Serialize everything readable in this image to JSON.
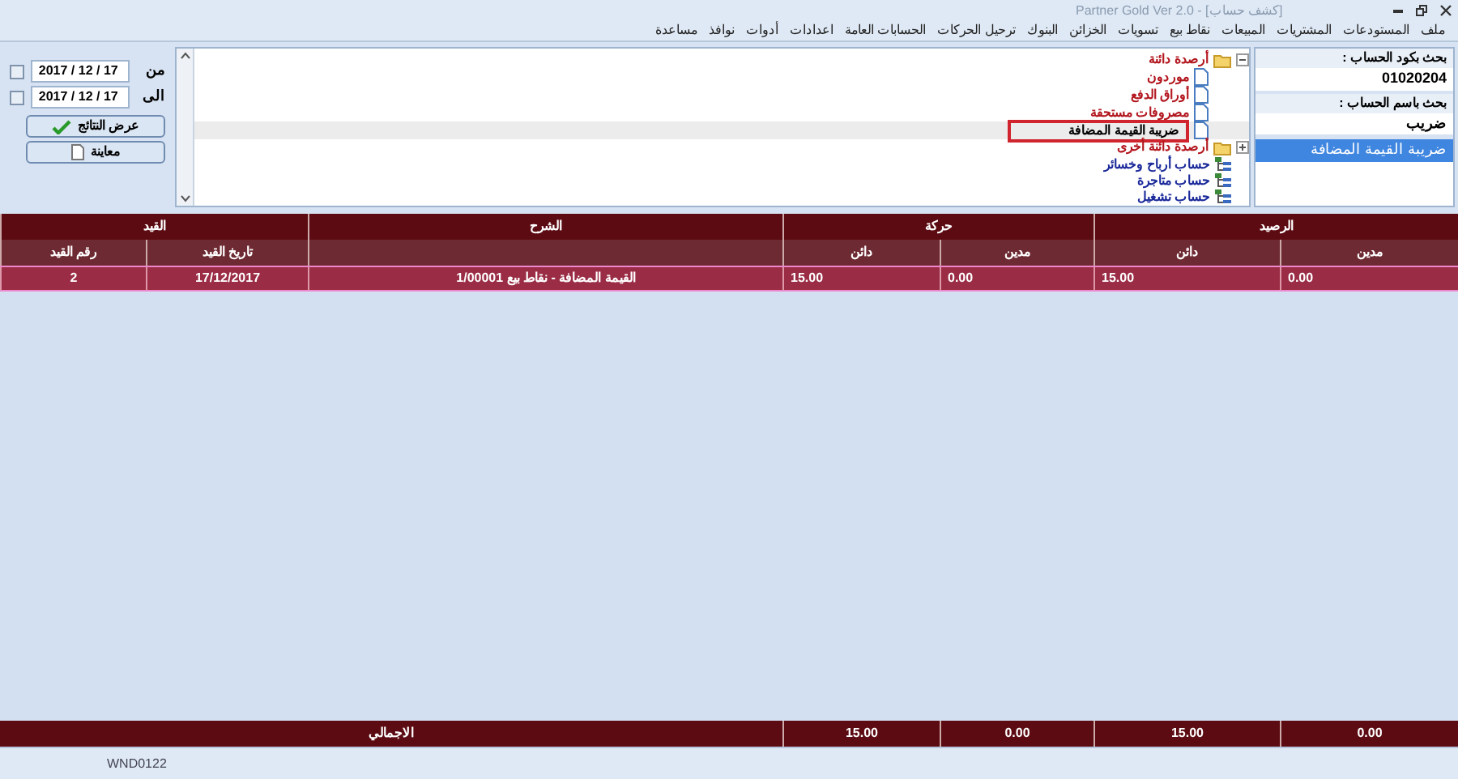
{
  "window": {
    "title": "[كشف حساب] - Partner Gold Ver 2.0"
  },
  "menu": [
    "ملف",
    "المستودعات",
    "المشتريات",
    "المبيعات",
    "نقاط بيع",
    "تسويات",
    "الخزائن",
    "البنوك",
    "ترحيل الحركات",
    "الحسابات العامة",
    "اعدادات",
    "أدوات",
    "نوافذ",
    "مساعدة"
  ],
  "search": {
    "code_label": "بحث بكود الحساب :",
    "code_value": "01020204",
    "name_label": "بحث باسم الحساب :",
    "name_value": "ضريب",
    "results": [
      {
        "label": "ضريبة القيمة المضافة",
        "selected": true
      }
    ]
  },
  "tree": [
    {
      "label": "أرصدة دائنة",
      "kind": "folder",
      "expanded": true,
      "selected": false,
      "children": [
        {
          "label": "موردون",
          "kind": "doc",
          "selected": false
        },
        {
          "label": "أوراق الدفع",
          "kind": "doc",
          "selected": false
        },
        {
          "label": "مصروفات مستحقة",
          "kind": "doc",
          "selected": false
        },
        {
          "label": "ضريبة القيمة المضافة",
          "kind": "doc",
          "selected": true
        }
      ]
    },
    {
      "label": "أرصدة دائنة أخرى",
      "kind": "folder",
      "expanded": false,
      "selected": false
    },
    {
      "label": "حساب أرباح وخسائر",
      "kind": "account",
      "selected": false
    },
    {
      "label": "حساب متاجرة",
      "kind": "account",
      "selected": false
    },
    {
      "label": "حساب تشغيل",
      "kind": "account",
      "selected": false
    }
  ],
  "filter": {
    "from_label": "من",
    "from_date": "2017 / 12 / 17",
    "from_checked": false,
    "to_label": "الى",
    "to_date": "2017 / 12 / 17",
    "to_checked": false,
    "buttons": [
      {
        "label": "عرض النتائج",
        "kind": "check"
      },
      {
        "label": "معاينة",
        "kind": "page"
      }
    ]
  },
  "table": {
    "groups": [
      "الرصيد",
      "حركة",
      "الشرح",
      "القيد"
    ],
    "columns": [
      "مدين",
      "دائن",
      "مدين",
      "دائن",
      "",
      "تاريخ القيد",
      "رقم القيد"
    ],
    "rows": [
      [
        "0.00",
        "15.00",
        "0.00",
        "15.00",
        "القيمة المضافة - نقاط بيع 1/00001",
        "17/12/2017",
        "2"
      ]
    ],
    "totals": {
      "values": [
        "0.00",
        "15.00",
        "0.00",
        "15.00"
      ],
      "label": "الاجمالي"
    }
  },
  "status_bar": {
    "text": "WND0122"
  }
}
